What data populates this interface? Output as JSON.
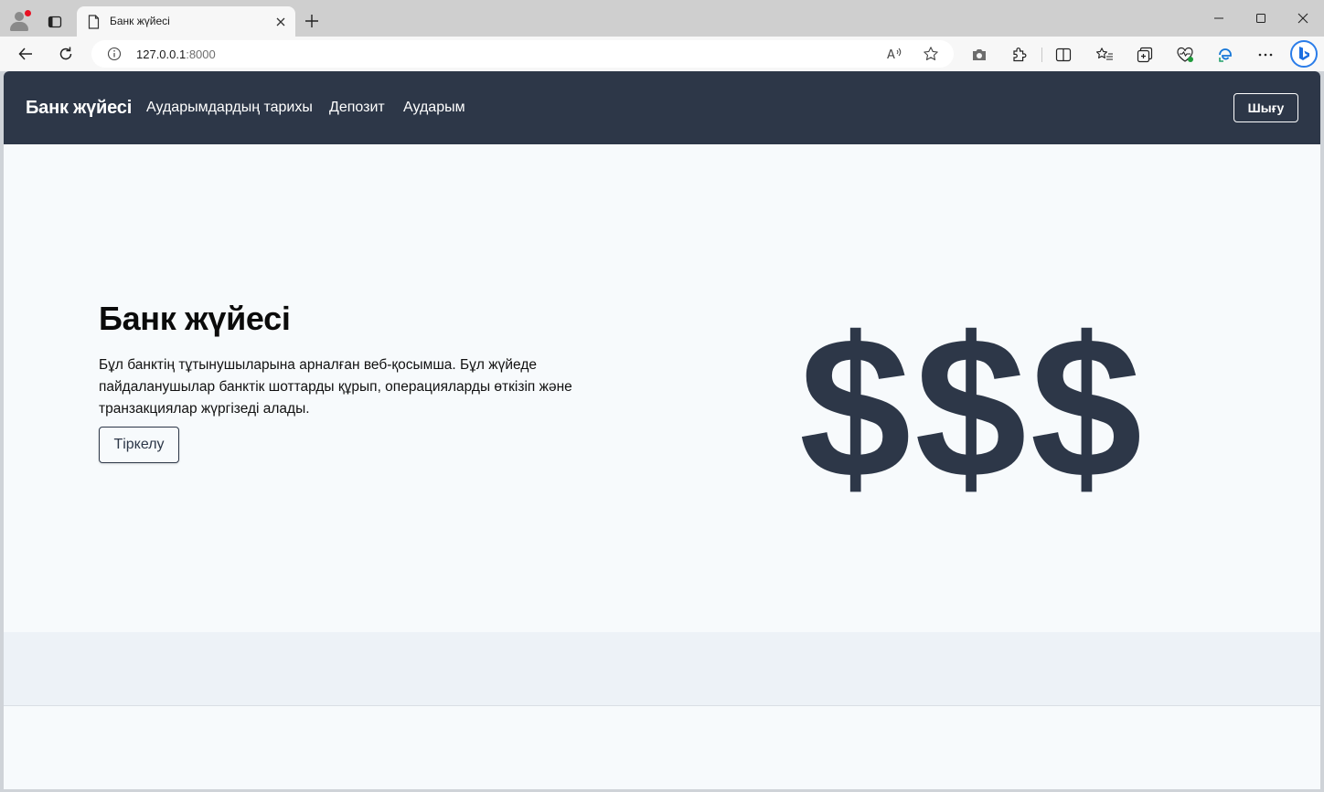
{
  "browser": {
    "tab_title": "Банк жүйесі",
    "url_host": "127.0.0.1",
    "url_port": ":8000",
    "icons": [
      "profile-icon",
      "tab-actions-icon",
      "page-icon",
      "close-icon",
      "new-tab-icon",
      "minimize-icon",
      "maximize-icon",
      "window-close-icon",
      "back-icon",
      "refresh-icon",
      "site-info-icon",
      "read-aloud-icon",
      "favorite-star-icon",
      "camera-icon",
      "extensions-icon",
      "split-screen-icon",
      "favorites-icon",
      "collections-icon",
      "browser-essentials-icon",
      "edge-icon",
      "more-icon",
      "bing-copilot-icon"
    ]
  },
  "site": {
    "brand": "Банк жүйесі",
    "nav": {
      "history": "Аударымдардың тарихы",
      "deposit": "Депозит",
      "transfer": "Аударым"
    },
    "logout_label": "Шығу"
  },
  "hero": {
    "title": "Банк жүйесі",
    "description": "Бұл банктің тұтынушыларына арналған веб-қосымша. Бұл жүйеде пайдаланушылар банктік шоттарды құрып, операцияларды өткізіп және транзакциялар жүргізеді алады.",
    "register_label": "Тіркелу",
    "dollar_art": "$$$"
  },
  "colors": {
    "navbar": "#2d3748",
    "page_bg": "#f7fafc",
    "footer_band": "#edf2f7"
  }
}
